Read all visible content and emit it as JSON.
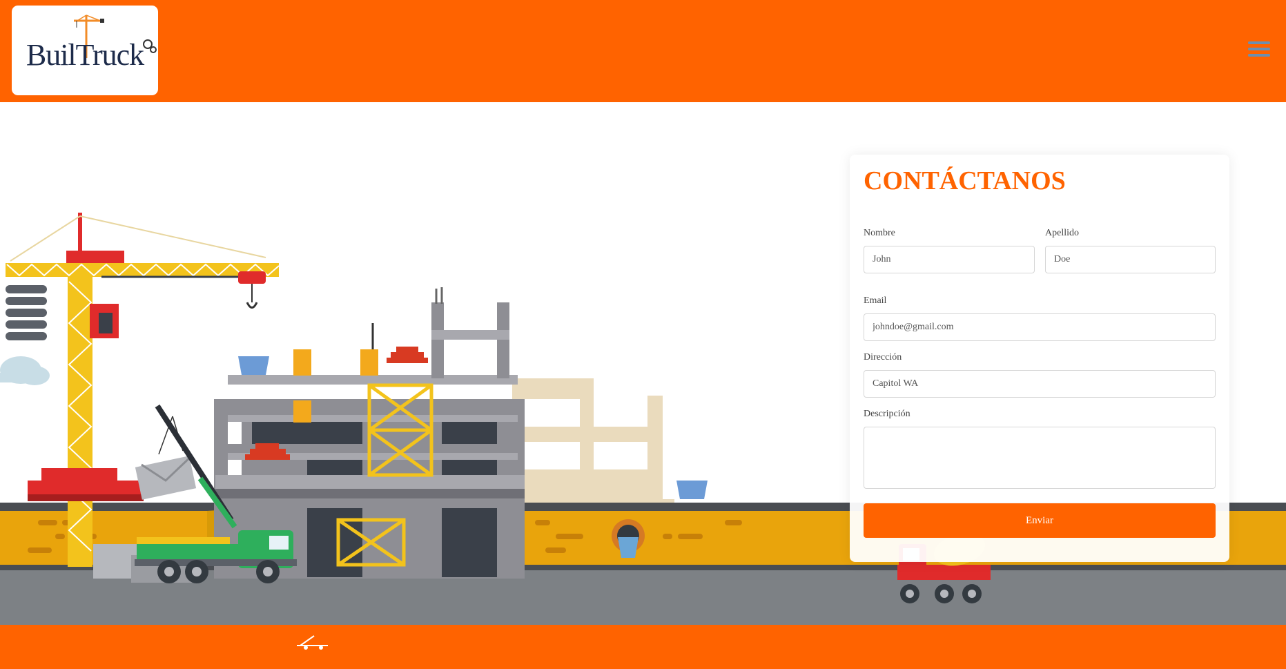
{
  "brand": {
    "logo_text": "BuilTruck"
  },
  "header": {
    "menu_icon": "hamburger-menu-icon"
  },
  "contact": {
    "title": "CONTÁCTANOS",
    "first_name": {
      "label": "Nombre",
      "placeholder": "John"
    },
    "last_name": {
      "label": "Apellido",
      "placeholder": "Doe"
    },
    "email": {
      "label": "Email",
      "placeholder": "johndoe@gmail.com"
    },
    "address": {
      "label": "Dirección",
      "placeholder": "Capitol WA"
    },
    "description": {
      "label": "Descripción"
    },
    "submit_label": "Enviar"
  },
  "colors": {
    "primary": "#ff6300",
    "navy": "#1d2b4a",
    "ground": "#e9a40c",
    "road": "#7d8185",
    "concrete": "#8e8e94",
    "steel": "#f3c31c"
  }
}
